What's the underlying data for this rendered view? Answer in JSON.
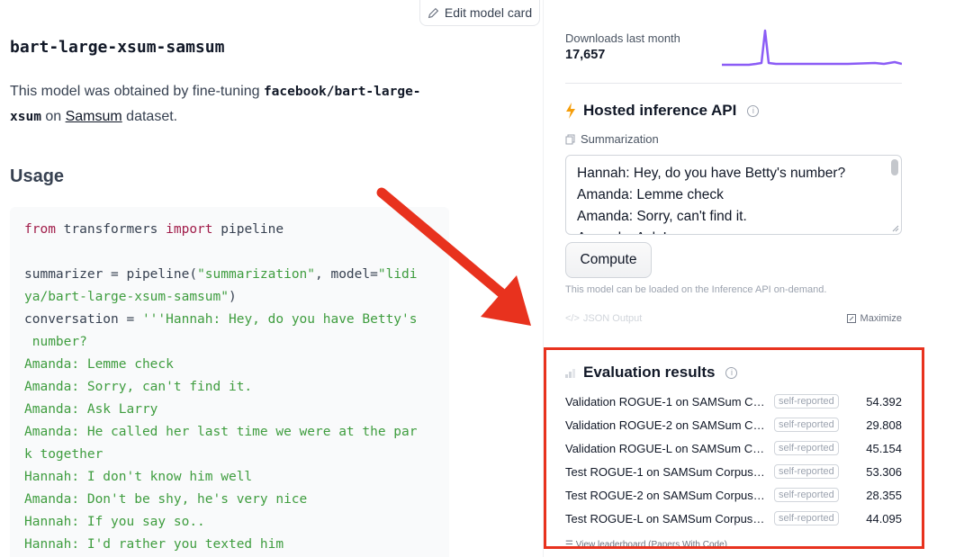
{
  "edit_button": {
    "label": "Edit model card",
    "icon": "pencil-icon"
  },
  "model": {
    "title": "bart-large-xsum-samsum",
    "desc_prefix": "This model was obtained by fine-tuning ",
    "desc_code": "facebook/bart-large-xsum",
    "desc_mid": " on ",
    "desc_link": "Samsum",
    "desc_suffix": " dataset."
  },
  "usage": {
    "heading": "Usage",
    "code": {
      "from_kw": "from",
      "line1_mid": " transformers ",
      "import_kw": "import",
      "line1_end": " pipeline",
      "line3_pre": "summarizer = pipeline(",
      "line3_str1": "\"summarization\"",
      "line3_mid": ", model=",
      "line3_str2a": "\"lidi",
      "line4_str": "ya/bart-large-xsum-samsum\"",
      "line4_end": ")",
      "line5_pre": "conversation = ",
      "line5_str": "'''Hannah: Hey, do you have Betty's",
      "line6": " number?",
      "line7": "Amanda: Lemme check",
      "line8": "Amanda: Sorry, can't find it.",
      "line9": "Amanda: Ask Larry",
      "line10": "Amanda: He called her last time we were at the par",
      "line11": "k together",
      "line12": "Hannah: I don't know him well",
      "line13": "Amanda: Don't be shy, he's very nice",
      "line14": "Hannah: If you say so..",
      "line15": "Hannah: I'd rather you texted him"
    }
  },
  "downloads": {
    "label": "Downloads last month",
    "value": "17,657",
    "color": "#8b5cf6"
  },
  "inference": {
    "title": "Hosted inference API",
    "task": "Summarization",
    "input_lines": [
      "Hannah: Hey, do you have Betty's number?",
      "Amanda: Lemme check",
      "Amanda: Sorry, can't find it.",
      "Amanda: Ask Larry"
    ],
    "compute_label": "Compute",
    "note": "This model can be loaded on the Inference API on-demand.",
    "json_output": "JSON Output",
    "maximize": "Maximize",
    "accent": "#f59e0b"
  },
  "evaluation": {
    "title": "Evaluation results",
    "badge": "self-reported",
    "rows": [
      {
        "name": "Validation ROGUE-1 on SAMSum Co...",
        "value": "54.392"
      },
      {
        "name": "Validation ROGUE-2 on SAMSum Co...",
        "value": "29.808"
      },
      {
        "name": "Validation ROGUE-L on SAMSum Co...",
        "value": "45.154"
      },
      {
        "name": "Test ROGUE-1 on SAMSum Corpus: ...",
        "value": "53.306"
      },
      {
        "name": "Test ROGUE-2 on SAMSum Corpus: ...",
        "value": "28.355"
      },
      {
        "name": "Test ROGUE-L on SAMSum Corpus: ...",
        "value": "44.095"
      }
    ],
    "leaderboard": "View leaderboard (Papers With Code)",
    "highlight_color": "#e8321e"
  }
}
